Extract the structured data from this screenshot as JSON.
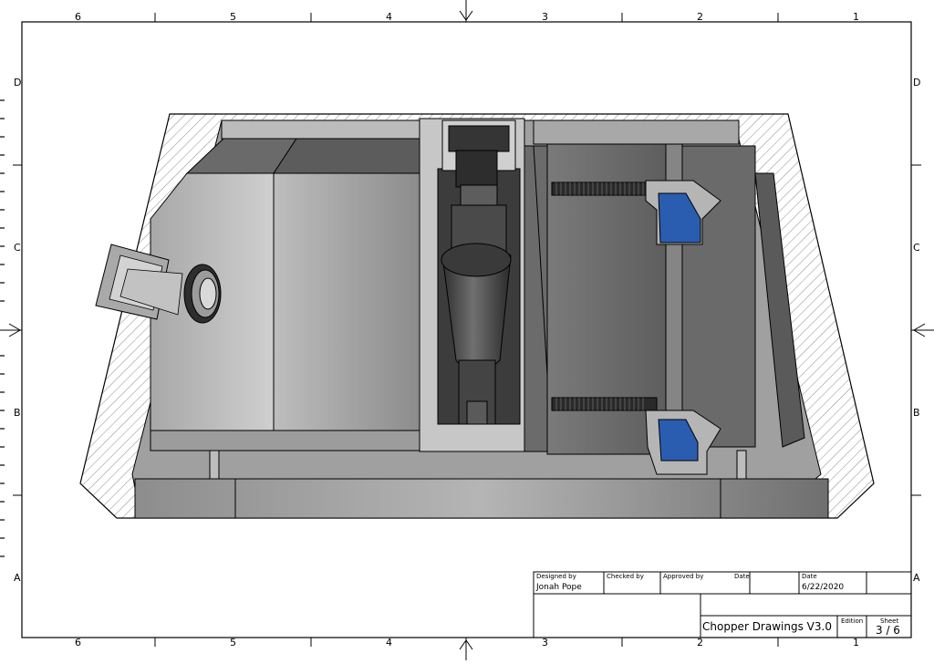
{
  "zones": {
    "top": [
      "6",
      "5",
      "4",
      "3",
      "2",
      "1"
    ],
    "bottom": [
      "6",
      "5",
      "4",
      "3",
      "2",
      "1"
    ],
    "left": [
      "D",
      "C",
      "B",
      "A"
    ],
    "right": [
      "D",
      "C",
      "B",
      "A"
    ]
  },
  "title_block": {
    "designed_by_label": "Designed by",
    "designed_by": "Jonah Pope",
    "checked_by_label": "Checked by",
    "approved_by_label": "Approved by",
    "date_label_1": "Date",
    "date_label_2": "Date",
    "date": "6/22/2020",
    "title": "Chopper Drawings V3.0",
    "edition_label": "Edition",
    "sheet_label": "Sheet",
    "sheet": "3 / 6"
  },
  "colors": {
    "accent_blue": "#2a5db0",
    "body_gray": "#8a8a8a",
    "dark_gray": "#3a3a3a",
    "hatch": "#9a9a9a"
  }
}
